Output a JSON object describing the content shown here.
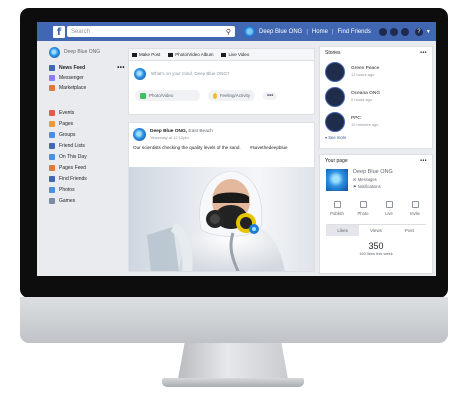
{
  "topbar": {
    "logo": "f",
    "search_placeholder": "Search",
    "profile_name": "Deep Blue ONG",
    "home": "Home",
    "find_friends": "Find Friends",
    "help": "?"
  },
  "left": {
    "profile_name": "Deep Blue ONG",
    "primary": [
      {
        "label": "News Feed",
        "color": "#4267b2"
      },
      {
        "label": "Messenger",
        "color": "#8b7cf6"
      },
      {
        "label": "Marketplace",
        "color": "#e0793a"
      }
    ],
    "more": "•••",
    "explore": [
      {
        "label": "Events",
        "color": "#e45b4c"
      },
      {
        "label": "Pages",
        "color": "#e89a3c"
      },
      {
        "label": "Groups",
        "color": "#4a90e2"
      },
      {
        "label": "Friend Lists",
        "color": "#4267b2"
      },
      {
        "label": "On This Day",
        "color": "#4a90e2"
      },
      {
        "label": "Pages Feed",
        "color": "#e0793a"
      },
      {
        "label": "Find Friends",
        "color": "#4267b2"
      },
      {
        "label": "Photos",
        "color": "#4a90e2"
      },
      {
        "label": "Games",
        "color": "#7a8ba6"
      }
    ]
  },
  "composer": {
    "tabs": [
      "Make Post",
      "Photo/Video Album",
      "Live Video"
    ],
    "prompt": "What's on your mind, Deep Blue ONG?",
    "photo_btn": "Photo/Video",
    "feeling_btn": "Feeling/Activity",
    "more": "•••"
  },
  "post": {
    "author": "Deep Blue ONG,",
    "location": "East Beach",
    "time": "Yesterday at 12:12pm",
    "text": "Our scientists checking the quality levels of the sand.",
    "hashtag": "#savethedeepblue"
  },
  "stories": {
    "title": "Stories",
    "more": "•••",
    "items": [
      {
        "name": "Green Peace",
        "time": "13 hours ago"
      },
      {
        "name": "Oceana ONG",
        "time": "2 hours ago"
      },
      {
        "name": "PPC",
        "time": "12 minutes ago"
      }
    ],
    "see_more": "See more"
  },
  "your_page": {
    "title": "Your page",
    "more": "•••",
    "name": "Deep Blue ONG",
    "messages": "Messages",
    "notifications": "Notifications",
    "actions": [
      "Publish",
      "Photo",
      "Live",
      "Invite"
    ],
    "tabs": [
      "Likes",
      "Views",
      "Post"
    ],
    "count": "350",
    "count_label": "160 likes this week"
  }
}
